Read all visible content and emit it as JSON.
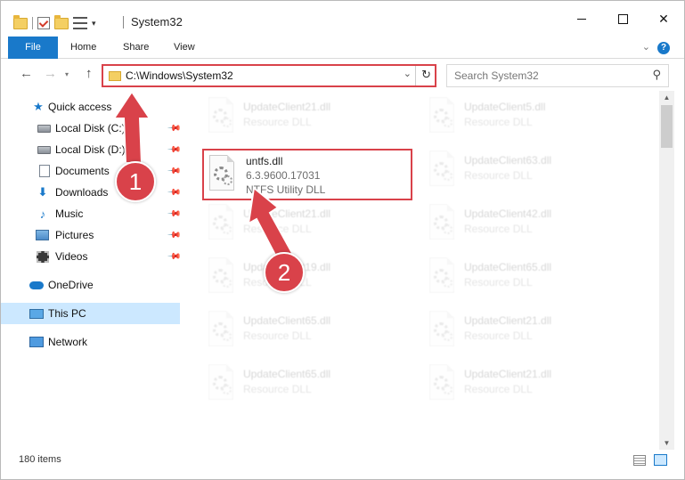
{
  "window": {
    "title": "System32",
    "minimize_label": "—",
    "maximize_label": "",
    "close_label": "✕"
  },
  "ribbon": {
    "tabs": [
      "File",
      "Home",
      "Share",
      "View"
    ],
    "help": "?"
  },
  "nav": {
    "address": "C:\\Windows\\System32",
    "search_placeholder": "Search System32"
  },
  "navpane": {
    "items": [
      {
        "label": "Quick access",
        "icon": "star-icon"
      },
      {
        "label": "Local Disk (C:)",
        "icon": "drive-icon",
        "pinned": true
      },
      {
        "label": "Local Disk (D:)",
        "icon": "drive-icon",
        "pinned": true
      },
      {
        "label": "Documents",
        "icon": "documents-icon",
        "pinned": true
      },
      {
        "label": "Downloads",
        "icon": "download-icon",
        "pinned": true
      },
      {
        "label": "Music",
        "icon": "music-icon",
        "pinned": true
      },
      {
        "label": "Pictures",
        "icon": "pictures-icon",
        "pinned": true
      },
      {
        "label": "Videos",
        "icon": "videos-icon",
        "pinned": true
      },
      {
        "label": "OneDrive",
        "icon": "cloud-icon"
      },
      {
        "label": "This PC",
        "icon": "pc-icon",
        "selected": true
      },
      {
        "label": "Network",
        "icon": "network-icon"
      }
    ]
  },
  "files": [
    {
      "name": "UpdateClient21.dll",
      "type": "Resource DLL"
    },
    {
      "name": "UpdateClient5.dll",
      "type": "Resource DLL"
    },
    {
      "name": "untfs.dll",
      "version": "6.3.9600.17031",
      "type": "NTFS Utility DLL"
    },
    {
      "name": "UpdateClient63.dll",
      "type": "Resource DLL"
    },
    {
      "name": "UpdateClient21.dll",
      "type": "Resource DLL"
    },
    {
      "name": "UpdateClient42.dll",
      "type": "Resource DLL"
    },
    {
      "name": "UpdateClient19.dll",
      "type": "Resource DLL"
    },
    {
      "name": "UpdateClient65.dll",
      "type": "Resource DLL"
    },
    {
      "name": "UpdateClient65.dll",
      "type": "Resource DLL"
    },
    {
      "name": "UpdateClient21.dll",
      "type": "Resource DLL"
    },
    {
      "name": "UpdateClient65.dll",
      "type": "Resource DLL"
    },
    {
      "name": "UpdateClient21.dll",
      "type": "Resource DLL"
    }
  ],
  "status": {
    "item_count": "180 items"
  },
  "annotations": {
    "step1": "1",
    "step2": "2"
  },
  "colors": {
    "accent": "#1979ca",
    "highlight_red": "#d9424a",
    "selection": "#cce8ff"
  }
}
